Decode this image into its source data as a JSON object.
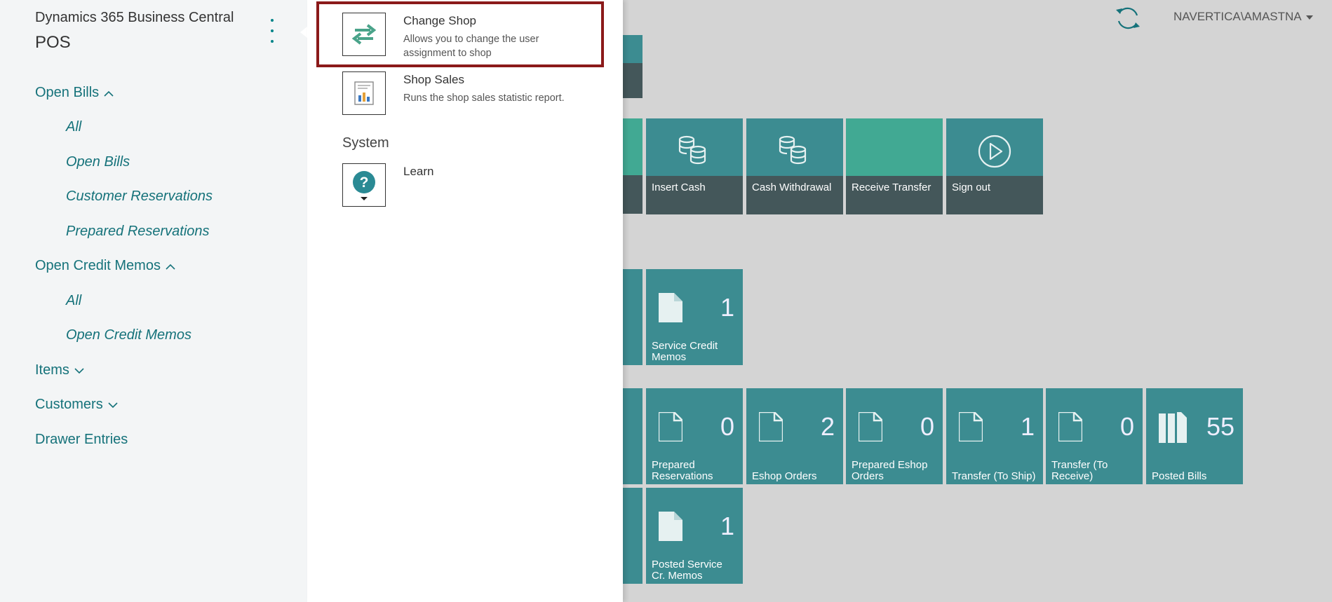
{
  "nav": {
    "app_name": "Dynamics 365 Business Central",
    "role": "POS",
    "items": [
      {
        "label": "Open Bills",
        "expanded": true
      },
      {
        "label": "All"
      },
      {
        "label": "Open Bills"
      },
      {
        "label": "Customer Reservations"
      },
      {
        "label": "Prepared Reservations"
      },
      {
        "label": "Open Credit Memos",
        "expanded": true
      },
      {
        "label": "All"
      },
      {
        "label": "Open Credit Memos"
      },
      {
        "label": "Items",
        "expanded": false
      },
      {
        "label": "Customers",
        "expanded": false
      },
      {
        "label": "Drawer Entries"
      }
    ]
  },
  "panel": {
    "actions": [
      {
        "title": "Change Shop",
        "desc": "Allows you to change the user assignment to shop",
        "icon": "swap-arrows-icon"
      },
      {
        "title": "Shop Sales",
        "desc": "Runs the shop sales statistic report.",
        "icon": "report-icon"
      }
    ],
    "section_system": "System",
    "learn": {
      "title": "Learn",
      "icon": "help-icon"
    }
  },
  "header": {
    "user": "NAVERTICA\\AMASTNA",
    "refresh_icon": "refresh-icon"
  },
  "tiles": {
    "actions": [
      {
        "label": "Insert Cash",
        "icon": "coins-icon"
      },
      {
        "label": "Cash Withdrawal",
        "icon": "coins-icon"
      },
      {
        "label": "Receive Transfer",
        "icon": ""
      },
      {
        "label": "Sign out",
        "icon": "play-circle-icon"
      }
    ],
    "service": [
      {
        "label": "Service Credit Memos",
        "count": "1"
      }
    ],
    "documents": [
      {
        "label": "Prepared Reservations",
        "count": "0"
      },
      {
        "label": "Eshop Orders",
        "count": "2"
      },
      {
        "label": "Prepared Eshop Orders",
        "count": "0"
      },
      {
        "label": "Transfer (To Ship)",
        "count": "1"
      },
      {
        "label": "Transfer (To Receive)",
        "count": "0"
      },
      {
        "label": "Posted Bills",
        "count": "55"
      }
    ],
    "posted": [
      {
        "label": "Posted Service Cr. Memos",
        "count": "1"
      }
    ]
  },
  "colors": {
    "accent": "#15727a",
    "tile": "#3c8c91",
    "tile_dark": "#44575a",
    "tile_green": "#41a993",
    "highlight": "#8b1a1a"
  }
}
